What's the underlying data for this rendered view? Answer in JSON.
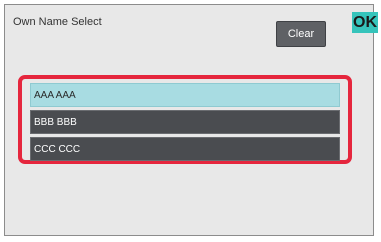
{
  "header": {
    "title": "Own Name Select",
    "clear_label": "Clear",
    "ok_label": "OK"
  },
  "names": {
    "items": [
      {
        "label": "AAA AAA",
        "selected": true
      },
      {
        "label": "BBB BBB",
        "selected": false
      },
      {
        "label": "CCC CCC",
        "selected": false
      }
    ]
  },
  "colors": {
    "ok_button": "#36c4bb",
    "highlight_border": "#e5263d",
    "selected_row": "#a8dce2",
    "row": "#4a4c50",
    "clear_button": "#5f6165"
  }
}
